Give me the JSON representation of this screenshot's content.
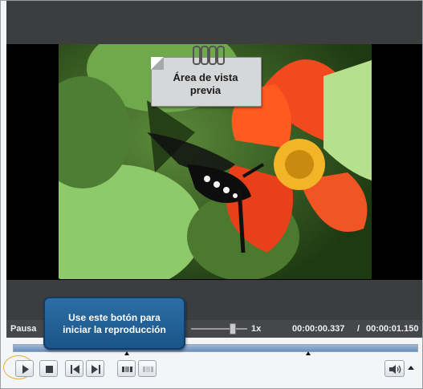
{
  "preview": {
    "note_line1": "Área de vista",
    "note_line2": "previa"
  },
  "status": {
    "state_label": "Pausa",
    "speed_label": "1x",
    "speed_level": 0.7,
    "time_current": "00:00:00.337",
    "time_separator": "/",
    "time_total": "00:00:01.150"
  },
  "timeline": {
    "markers": 2
  },
  "tooltip": {
    "line1": "Use este botón para",
    "line2": "iniciar la reproducción"
  },
  "controls": {
    "play": "play-icon",
    "stop": "stop-icon",
    "prev_frame": "skip-previous-icon",
    "next_frame": "skip-next-icon",
    "segment_a": "segment-icon",
    "segment_b": "segment-disabled-icon",
    "volume": "speaker-icon",
    "volume_menu": "chevron-up-icon"
  },
  "colors": {
    "accent_blue": "#1a5488",
    "highlight_ring": "#e0b040",
    "status_bar": "#45474a"
  }
}
